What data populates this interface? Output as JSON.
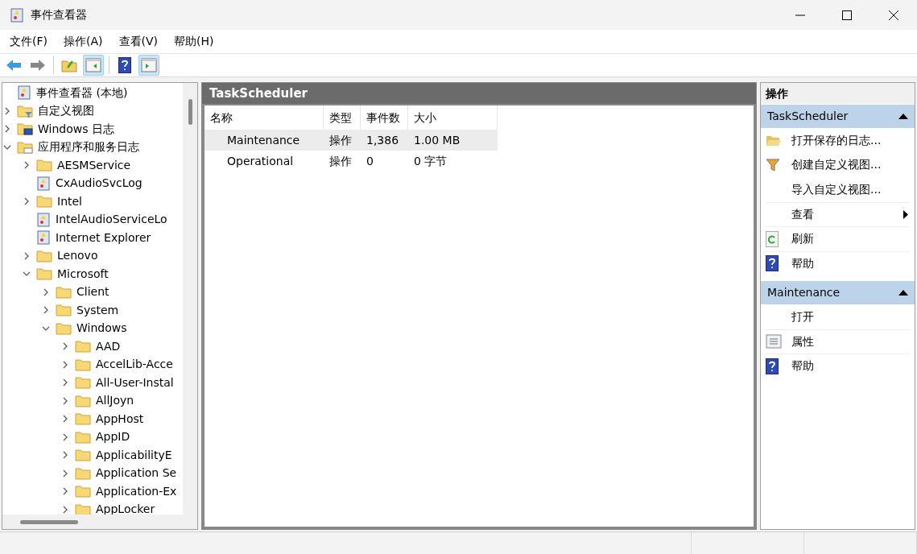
{
  "window": {
    "title": "事件查看器"
  },
  "menu": [
    "文件(F)",
    "操作(A)",
    "查看(V)",
    "帮助(H)"
  ],
  "toolbar": [
    {
      "kind": "back",
      "selected": false
    },
    {
      "kind": "forward",
      "selected": false
    },
    {
      "kind": "up",
      "selected": false
    },
    {
      "kind": "tree-toggle",
      "selected": true
    },
    {
      "kind": "help",
      "selected": false
    },
    {
      "kind": "action-toggle",
      "selected": true
    }
  ],
  "tree": [
    {
      "label": "事件查看器 (本地)",
      "kind": "root",
      "children": [
        {
          "label": "自定义视图",
          "kind": "filter-folder",
          "expanded": false
        },
        {
          "label": "Windows 日志",
          "kind": "system-folder",
          "expanded": false
        },
        {
          "label": "应用程序和服务日志",
          "kind": "logs-folder",
          "expanded": true,
          "children": [
            {
              "label": "AESMService",
              "kind": "folder",
              "expanded": false
            },
            {
              "label": "CxAudioSvcLog",
              "kind": "log"
            },
            {
              "label": "Intel",
              "kind": "folder",
              "expanded": false
            },
            {
              "label": "IntelAudioServiceLo",
              "kind": "log"
            },
            {
              "label": "Internet Explorer",
              "kind": "log"
            },
            {
              "label": "Lenovo",
              "kind": "folder",
              "expanded": false
            },
            {
              "label": "Microsoft",
              "kind": "folder",
              "expanded": true,
              "children": [
                {
                  "label": "Client",
                  "kind": "folder",
                  "expanded": false
                },
                {
                  "label": "System",
                  "kind": "folder",
                  "expanded": false
                },
                {
                  "label": "Windows",
                  "kind": "folder",
                  "expanded": true,
                  "children": [
                    {
                      "label": "AAD",
                      "kind": "folder",
                      "expanded": false
                    },
                    {
                      "label": "AccelLib-Acce",
                      "kind": "folder",
                      "expanded": false
                    },
                    {
                      "label": "All-User-Instal",
                      "kind": "folder",
                      "expanded": false
                    },
                    {
                      "label": "AllJoyn",
                      "kind": "folder",
                      "expanded": false
                    },
                    {
                      "label": "AppHost",
                      "kind": "folder",
                      "expanded": false
                    },
                    {
                      "label": "AppID",
                      "kind": "folder",
                      "expanded": false
                    },
                    {
                      "label": "ApplicabilityE",
                      "kind": "folder",
                      "expanded": false
                    },
                    {
                      "label": "Application Se",
                      "kind": "folder",
                      "expanded": false
                    },
                    {
                      "label": "Application-Ex",
                      "kind": "folder",
                      "expanded": false
                    },
                    {
                      "label": "AppLocker",
                      "kind": "folder",
                      "expanded": false
                    }
                  ]
                }
              ]
            }
          ]
        }
      ]
    }
  ],
  "content": {
    "title": "TaskScheduler",
    "table": {
      "columns": [
        "名称",
        "类型",
        "事件数",
        "大小"
      ],
      "rows": [
        {
          "cells": [
            "Maintenance",
            "操作",
            "1,386",
            "1.00 MB"
          ],
          "selected": true
        },
        {
          "cells": [
            "Operational",
            "操作",
            "0",
            "0 字节"
          ],
          "selected": false
        }
      ]
    }
  },
  "actions": {
    "title": "操作",
    "sections": [
      {
        "title": "TaskScheduler",
        "expanded": true,
        "items": [
          {
            "label": "打开保存的日志...",
            "kind": "open-folder"
          },
          {
            "label": "创建自定义视图...",
            "kind": "filter"
          },
          {
            "label": "导入自定义视图...",
            "kind": "none"
          },
          {
            "label": "查看",
            "kind": "submenu"
          },
          {
            "label": "刷新",
            "kind": "refresh"
          },
          {
            "label": "帮助",
            "kind": "help"
          }
        ]
      },
      {
        "title": "Maintenance",
        "expanded": true,
        "items": [
          {
            "label": "打开",
            "kind": "none"
          },
          {
            "label": "属性",
            "kind": "properties"
          },
          {
            "label": "帮助",
            "kind": "help"
          }
        ]
      }
    ]
  }
}
